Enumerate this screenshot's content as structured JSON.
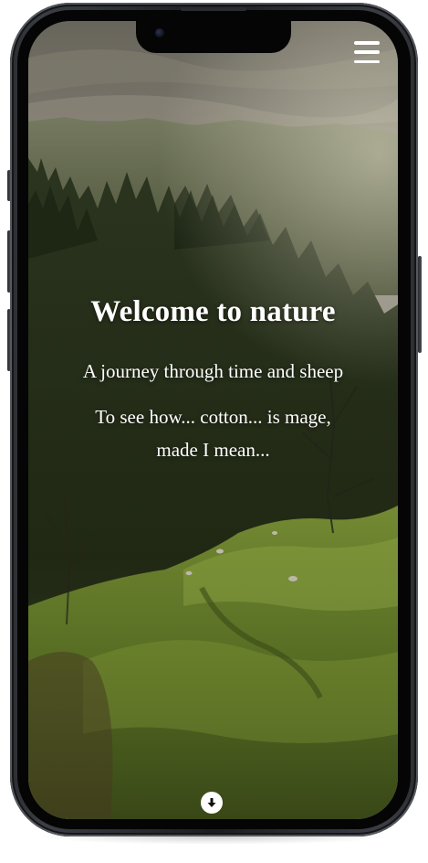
{
  "hero": {
    "title": "Welcome to nature",
    "tagline": "A journey through time and sheep",
    "subtitle": "To see how... cotton... is mage, made I mean..."
  },
  "icons": {
    "menu": "hamburger-menu-icon",
    "scroll": "arrow-down-circle-icon"
  },
  "colors": {
    "text": "#ffffff",
    "phone_frame": "#2b2d31",
    "meadow": "#8aa23a",
    "forest": "#2e3a1e",
    "sky": "#c9c4b6"
  }
}
